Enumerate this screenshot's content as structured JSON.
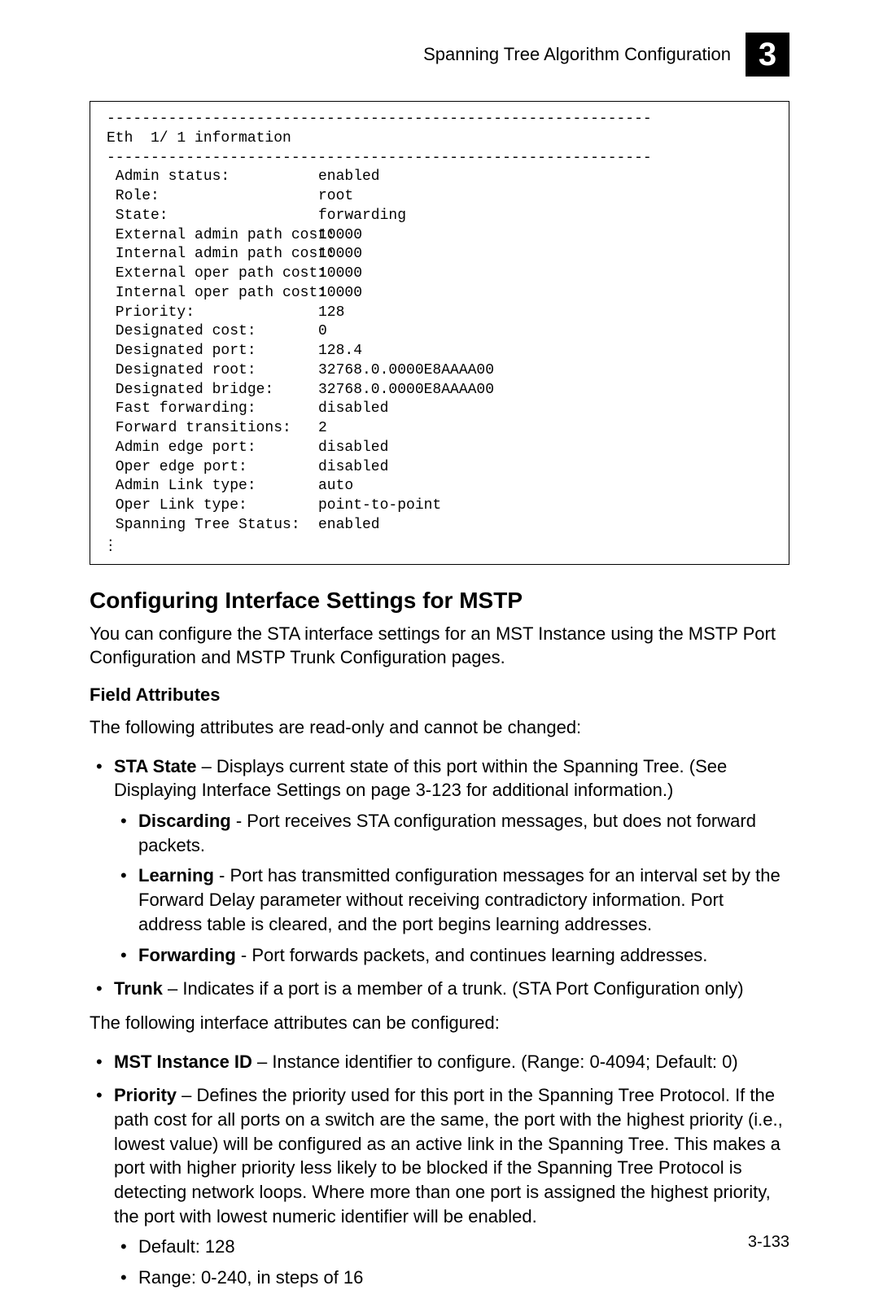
{
  "header": {
    "title": "Spanning Tree Algorithm Configuration",
    "chapter_number": "3"
  },
  "code_block": {
    "divider": "--------------------------------------------------------------",
    "interface_title": "Eth  1/ 1 information",
    "rows": [
      {
        "label": " Admin status:",
        "value": "enabled"
      },
      {
        "label": " Role:",
        "value": "root"
      },
      {
        "label": " State:",
        "value": "forwarding"
      },
      {
        "label": " External admin path cost:",
        "value": "10000"
      },
      {
        "label": " Internal admin path cost:",
        "value": "10000"
      },
      {
        "label": " External oper path cost:",
        "value": "10000"
      },
      {
        "label": " Internal oper path cost:",
        "value": "10000"
      },
      {
        "label": " Priority:",
        "value": "128"
      },
      {
        "label": " Designated cost:",
        "value": "0"
      },
      {
        "label": " Designated port:",
        "value": "128.4"
      },
      {
        "label": " Designated root:",
        "value": "32768.0.0000E8AAAA00"
      },
      {
        "label": " Designated bridge:",
        "value": "32768.0.0000E8AAAA00"
      },
      {
        "label": " Fast forwarding:",
        "value": "disabled"
      },
      {
        "label": " Forward transitions:",
        "value": "2"
      },
      {
        "label": " Admin edge port:",
        "value": "disabled"
      },
      {
        "label": " Oper edge port:",
        "value": "disabled"
      },
      {
        "label": " Admin Link type:",
        "value": "auto"
      },
      {
        "label": " Oper Link type:",
        "value": "point-to-point"
      },
      {
        "label": " Spanning Tree Status:",
        "value": "enabled"
      }
    ]
  },
  "section": {
    "heading": "Configuring Interface Settings for MSTP",
    "intro": "You can configure the STA interface settings for an MST Instance using the MSTP Port Configuration and MSTP Trunk Configuration pages.",
    "field_attr_heading": "Field Attributes",
    "readonly_intro": "The following attributes are read-only and cannot be changed:",
    "sta_state": {
      "bold": "STA State",
      "rest": " – Displays current state of this port within the Spanning Tree. (See Displaying Interface Settings on page 3-123 for additional information.)",
      "sub": [
        {
          "bold": "Discarding",
          "rest": " - Port receives STA configuration messages, but does not forward packets."
        },
        {
          "bold": "Learning",
          "rest": " - Port has transmitted configuration messages for an interval set by the Forward Delay parameter without receiving contradictory information. Port address table is cleared, and the port begins learning addresses."
        },
        {
          "bold": "Forwarding",
          "rest": " - Port forwards packets, and continues learning addresses."
        }
      ]
    },
    "trunk": {
      "bold": "Trunk",
      "rest": " – Indicates if a port is a member of a trunk. (STA Port Configuration only)"
    },
    "config_intro": "The following interface attributes can be configured:",
    "mst_id": {
      "bold": "MST Instance ID",
      "rest": " – Instance identifier to configure. (Range: 0-4094; Default: 0)"
    },
    "priority": {
      "bold": "Priority",
      "rest": " – Defines the priority used for this port in the Spanning Tree Protocol. If the path cost for all ports on a switch are the same, the port with the highest priority (i.e., lowest value) will be configured as an active link in the Spanning Tree. This makes a port with higher priority less likely to be blocked if the Spanning Tree Protocol is detecting network loops. Where more than one port is assigned the highest priority, the port with lowest numeric identifier will be enabled.",
      "sub": [
        {
          "text": "Default: 128"
        },
        {
          "text": "Range: 0-240, in steps of 16"
        }
      ]
    }
  },
  "page_number": "3-133"
}
